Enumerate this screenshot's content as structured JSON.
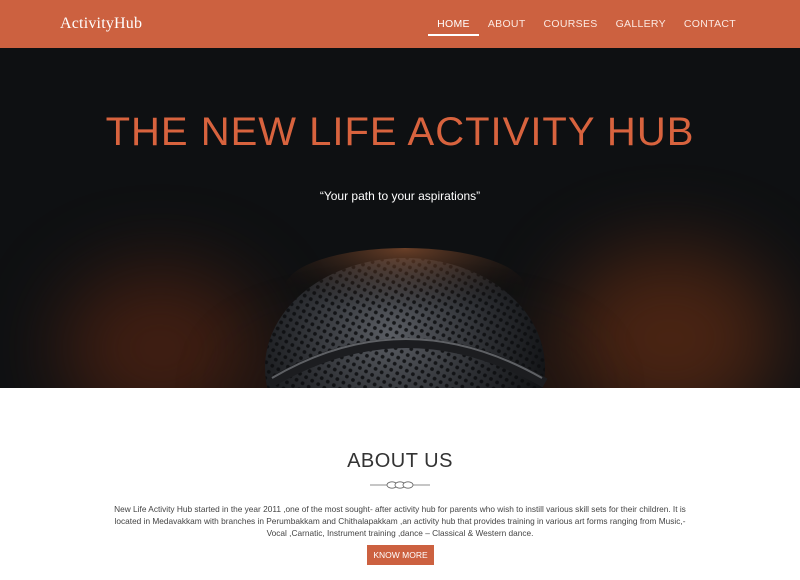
{
  "header": {
    "brand": "ActivityHub",
    "nav": [
      {
        "label": "HOME",
        "active": true
      },
      {
        "label": "ABOUT",
        "active": false
      },
      {
        "label": "COURSES",
        "active": false
      },
      {
        "label": "GALLERY",
        "active": false
      },
      {
        "label": "CONTACT",
        "active": false
      }
    ]
  },
  "hero": {
    "title": "THE NEW LIFE ACTIVITY HUB",
    "subtitle": "“Your path to your aspirations”",
    "background_icon": "microphone-icon"
  },
  "about": {
    "title": "ABOUT US",
    "divider_icon": "ornament-divider-icon",
    "text": "New Life Activity Hub started in the year 2011 ,one of the most sought- after activity hub for parents who wish to instill various skill sets for their children. It is located in Medavakkam with branches in Perumbakkam and Chithalapakkam ,an activity hub that provides training in various art forms ranging from Music,-Vocal ,Carnatic, Instrument training ,dance – Classical & Western dance.",
    "button_label": "KNOW MORE"
  },
  "colors": {
    "accent": "#cc6140",
    "hero_title": "#d8633e",
    "hero_bg": "#0e1012",
    "text": "#444444"
  }
}
